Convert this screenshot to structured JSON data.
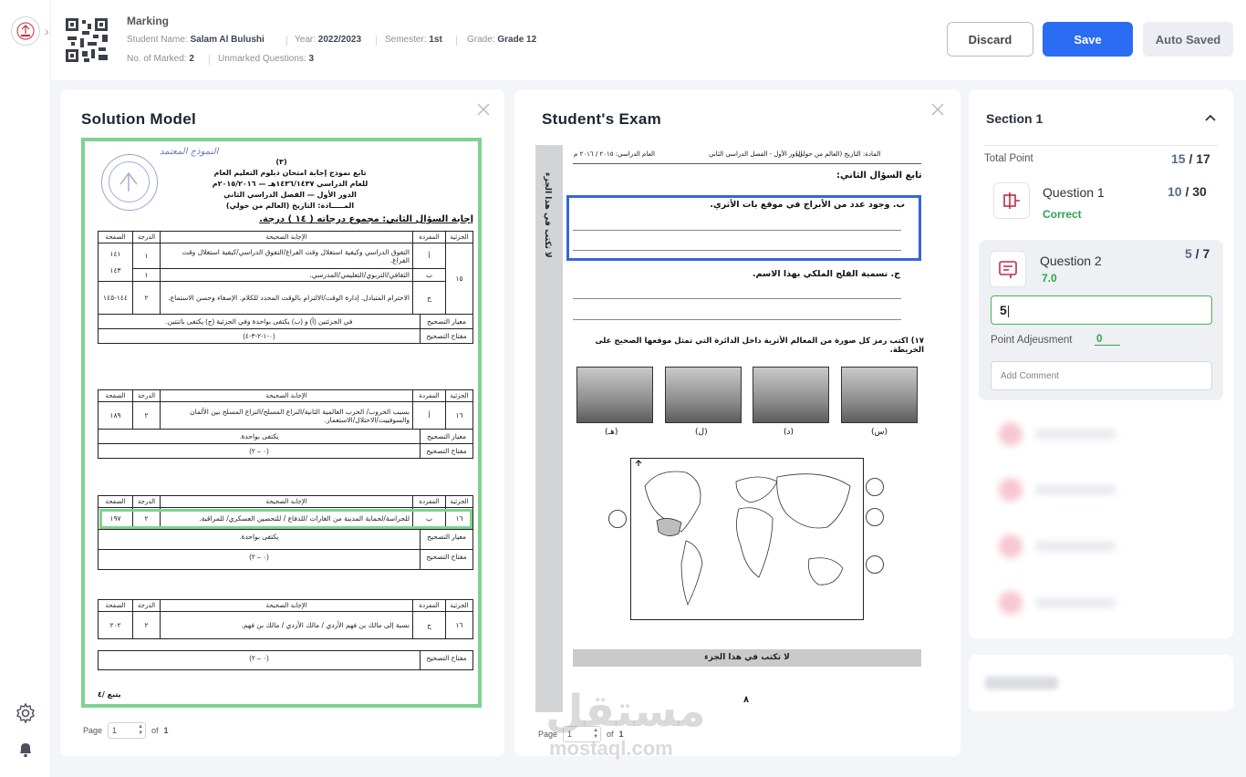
{
  "header": {
    "title": "Marking",
    "student_label": "Student Name:",
    "student_name": "Salam Al Bulushi",
    "year_label": "Year:",
    "year": "2022/2023",
    "semester_label": "Semester:",
    "semester": "1st",
    "grade_label": "Grade:",
    "grade": "Grade 12",
    "marked_label": "No. of Marked:",
    "marked": "2",
    "unmarked_label": "Unmarked Questions:",
    "unmarked": "3",
    "discard": "Discard",
    "save": "Save",
    "auto_saved": "Auto Saved"
  },
  "solution": {
    "title": "Solution Model",
    "page_label": "Page",
    "page_value": "1",
    "of_label": "of",
    "total_pages": "1",
    "doc": {
      "stamp_note": "النموذج المعتمد",
      "page_no": "(٣)",
      "h1": "تابع نموذج إجابة امتحان دبلوم التعليم العام",
      "h2": "للعام الدراسي ١٤٣٦/١٤٣٧هـ — ٢٠١٥/٢٠١٦م",
      "h3": "الدور الأول — الفصل الدراسي الثاني",
      "h4": "المـــــادة: التاريخ (العالم من حولي)",
      "section": "إجابة السؤال الثاني: مجموع درجاته ( ١٤ ) درجة.",
      "cols": [
        "الجزئية",
        "المفردة",
        "الإجابة الصحيحة",
        "الدرجة",
        "الصفحة"
      ],
      "criteria_label": "معيار التصحيح",
      "key_label": "مفتاح التصحيح",
      "t1": {
        "part": "١٥",
        "rows": [
          {
            "item": "أ",
            "answer": "التفوق الدراسي وكيفية استغلال وقت الفراغ/التفوق الدراسي/كيفية استغلال وقت الفراغ.",
            "grade": "١",
            "page": "١٤١"
          },
          {
            "item": "ب",
            "answer": "الثقافي/التربوي/التعليمي/المدرسي.",
            "grade": "١",
            "page": "١٤٣"
          },
          {
            "item": "ج",
            "answer": "الاحترام المتبادل. إدارة الوقت/الالتزام بالوقت المحدد للكلام. الإصغاء وحسن الاستماع.",
            "grade": "٢",
            "page": "١٤٤-١٤٥"
          }
        ],
        "criteria": "في الجزئتين (أ) و (ب) يكتفى بواحدة وفي الجزئية (ج) يكتفى باثنتين.",
        "key": "(٠-١-٢-٣-٤)"
      },
      "t2": {
        "part": "١٦",
        "item": "أ",
        "answer": "بسبب الحروب/ الحرب العالمية الثانية/النزاع المسلح/النزاع المسلح بين الألمان والسوفييت/الاحتلال/الاستعمار.",
        "grade": "٢",
        "page": "١٨٩",
        "criteria": "يكتفى بواحدة.",
        "key": "(٠ – ٢)"
      },
      "t3": {
        "part": "١٦",
        "item": "ب",
        "answer": "للحراسة/لحماية المدينة من الغارات /للدفاع / للتحصين العسكري/ للمراقبة.",
        "grade": "٢",
        "page": "١٩٧",
        "criteria": "يكتفى بواحدة.",
        "key": "(٠ – ٢)"
      },
      "t4": {
        "part": "١٦",
        "item": "ج",
        "answer": "نسبة إلى مالك بن فهم الأزدي / مالك الأزدي / مالك بن فهم.",
        "grade": "٢",
        "page": "٢٠٢",
        "key": "(٠ – ٢)"
      },
      "continues": "يتبع /٤"
    }
  },
  "exam": {
    "title": "Student's Exam",
    "page_label": "Page",
    "page_value": "1",
    "of_label": "of",
    "total_pages": "1",
    "doc": {
      "strip": "لا تكتب في هذا الجزء",
      "top_subject": "المادة: التاريخ (العالم من حولي)",
      "top_round": "الدور الأول - الفصل الدراسي الثاني",
      "top_year": "العام الدراسي: ٢٠١٥ / ٢٠١٦ م",
      "continue_q": "تابع السؤال الثاني:",
      "q_b": "ب.    وجود عدد من الأبراج في موقع بات الأثري.",
      "q_c": "ج.    تسمية الفلج الملكي بهذا الاسم.",
      "q17": "١٧) اكتب رمز كل صورة من المعالم الأثرية داخل الدائرة التي تمثل موقعها الصحيح على الخريطة.",
      "pic_labels": [
        "(هـ)",
        "(ل)",
        "(د)",
        "(س)"
      ],
      "bottom_note": "لا تكتب في هذا الجزء",
      "page_num": "٨"
    }
  },
  "side": {
    "section_title": "Section 1",
    "total_label": "Total Point",
    "total_got": "15",
    "total_max": "17",
    "q1": {
      "name": "Question 1",
      "status": "Correct",
      "got": "10",
      "max": "30"
    },
    "q2": {
      "name": "Question 2",
      "value": "7.0",
      "got": "5",
      "max": "7",
      "input_value": "5",
      "adj_label": "Point Adjeusment",
      "adj_value": "0",
      "comment_placeholder": "Add Comment"
    }
  },
  "watermark": {
    "arabic": "مستقل",
    "latin": "mostaql.com"
  },
  "colors": {
    "accent": "#2a6cf2",
    "success": "#2aa44f",
    "solution_border": "#7fd28e",
    "highlight": "#3566d8"
  }
}
